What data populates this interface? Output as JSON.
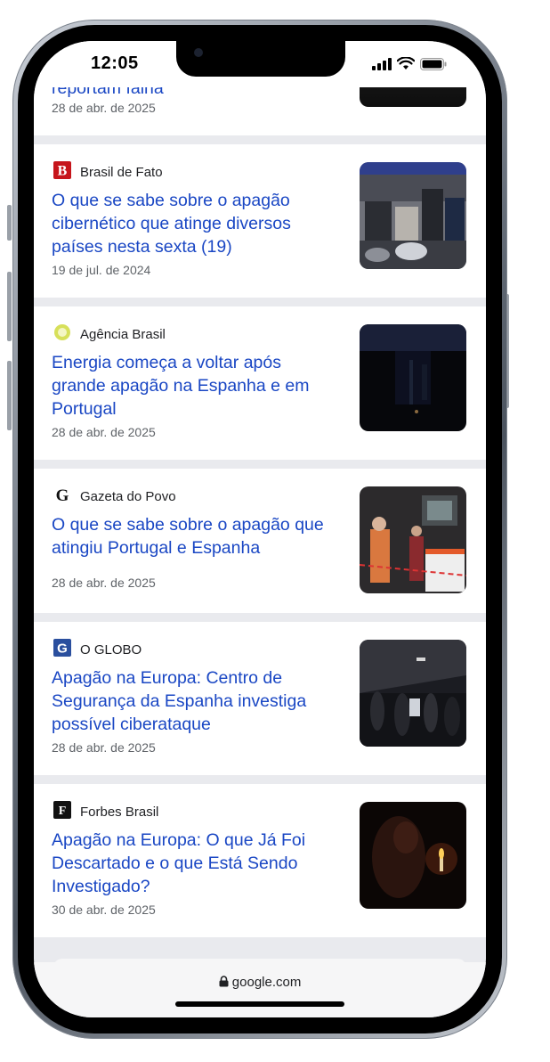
{
  "status": {
    "time": "12:05"
  },
  "partial_card": {
    "headline_tail": "reportam falha",
    "date": "28 de abr. de 2025"
  },
  "articles": [
    {
      "source": "Brasil de Fato",
      "headline": "O que se sabe sobre o apagão cibernético que atinge diversos países nesta sexta (19)",
      "date": "19 de jul. de 2024",
      "icon": "brasil-de-fato-logo"
    },
    {
      "source": "Agência Brasil",
      "headline": "Energia começa a voltar após grande apagão na Espanha e em Portugal",
      "date": "28 de abr. de 2025",
      "icon": "agencia-brasil-logo"
    },
    {
      "source": "Gazeta do Povo",
      "headline": "O que se sabe sobre o apagão que atingiu Portugal e Espanha",
      "date": "28 de abr. de 2025",
      "icon": "gazeta-do-povo-logo"
    },
    {
      "source": "O GLOBO",
      "headline": "Apagão na Europa: Centro de Segurança da Espanha investiga possível ciberataque",
      "date": "28 de abr. de 2025",
      "icon": "o-globo-logo"
    },
    {
      "source": "Forbes Brasil",
      "headline": "Apagão na Europa: O que Já Foi Descartado e o que Está Sendo Investigado?",
      "date": "30 de abr. de 2025",
      "icon": "forbes-brasil-logo"
    }
  ],
  "browser": {
    "url": "google.com"
  },
  "colors": {
    "link": "#1a47c4",
    "separator": "#e9eaee"
  }
}
